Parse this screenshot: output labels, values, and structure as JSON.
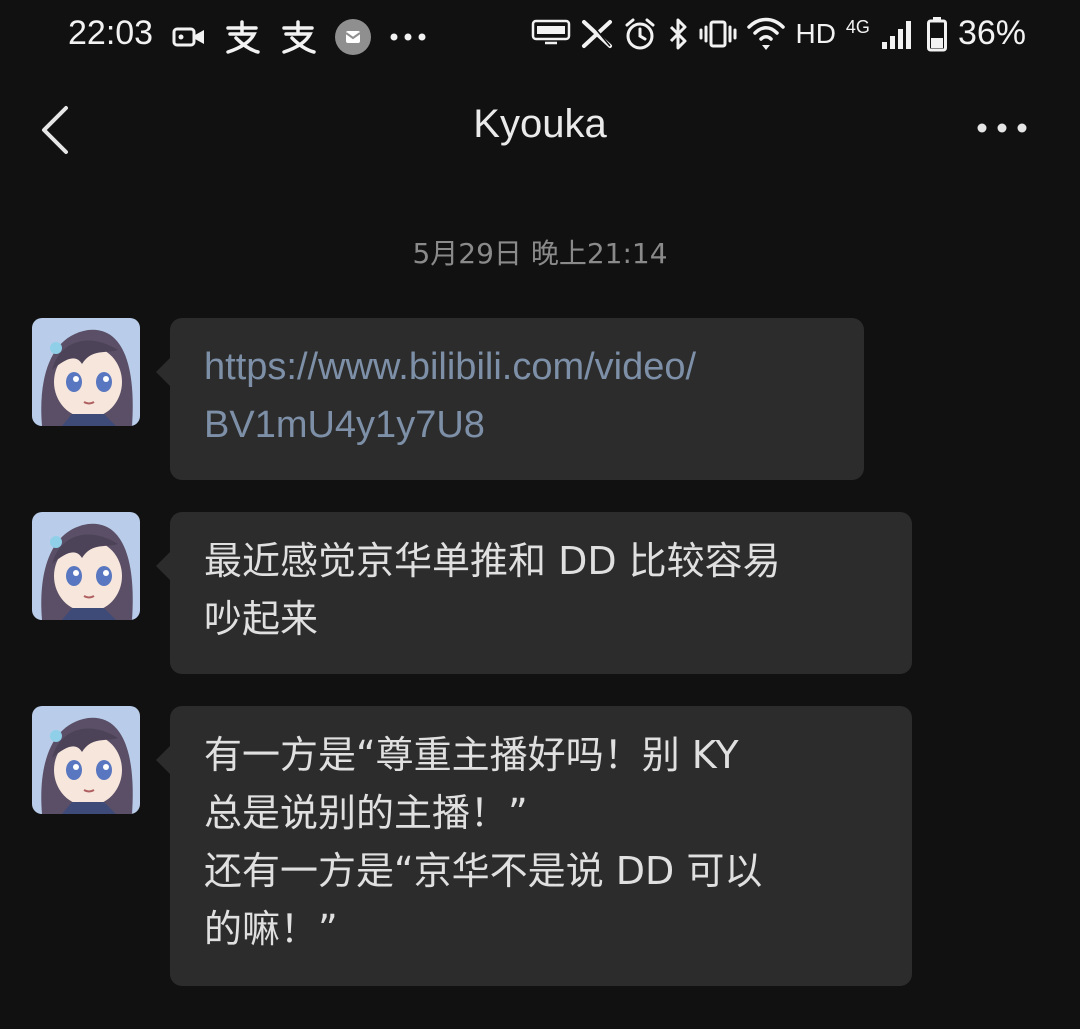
{
  "status_bar": {
    "time": "22:03",
    "left_icons": [
      "video-icon",
      "alipay-icon",
      "alipay-icon",
      "notification-icon",
      "more-dots-icon"
    ],
    "hd": "HD",
    "network": "4G",
    "battery_percent": "36%",
    "battery_level": 0.36
  },
  "header": {
    "title": "Kyouka"
  },
  "timestamp": "5月29日 晚上21:14",
  "messages": [
    {
      "lines": [
        "https://www.bilibili.com/video/",
        "BV1mU4y1y7U8"
      ],
      "is_link": true
    },
    {
      "lines": [
        "最近感觉京华单推和 DD 比较容易",
        "吵起来"
      ]
    },
    {
      "lines": [
        "有一方是“尊重主播好吗！别 KY",
        "总是说别的主播！”",
        "还有一方是“京华不是说 DD 可以",
        "的嘛！”"
      ]
    }
  ]
}
